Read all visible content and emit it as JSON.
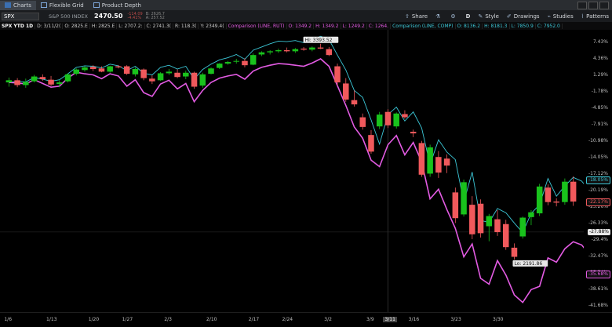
{
  "tabs": [
    {
      "label": "Charts",
      "active": true
    },
    {
      "label": "Flexible Grid",
      "active": false
    },
    {
      "label": "Product Depth",
      "active": false
    }
  ],
  "toolbar": {
    "symbol": "SPX",
    "description": "S&P 500 INDEX",
    "last_price": "2470.50",
    "change": "-114.09",
    "change_pct": "-4.41%",
    "bid": "B: 2626.7",
    "ask": "A: 257.52",
    "buttons": [
      "Share",
      "D",
      "Style",
      "Drawings",
      "Studies",
      "Patterns"
    ]
  },
  "infobar": {
    "title": "SPX YTD 1D",
    "ohlc": [
      "D: 3/11/2(",
      "O: 2825.E",
      "H: 2825.E",
      "L: 2707.2:",
      "C: 2741.3(",
      "R: 118.3(",
      "Y: 2349.4("
    ],
    "comp1": {
      "name": "Comparison (LINE, RUT)",
      "vals": [
        "O: 1349.2",
        "H: 1349.2",
        "L: 1249.2",
        "C: 1264."
      ]
    },
    "comp2": {
      "name": "Comparison (LINE, COMP)",
      "vals": [
        "O: 8136.2",
        "H: 8181.3",
        "L: 7850.9",
        "C: 7952.0"
      ]
    }
  },
  "annotations": {
    "hi": "Hi: 3393.52",
    "lo": "Lo: 2191.86"
  },
  "colors": {
    "up": "#19c21c",
    "down": "#f0595c",
    "rut": "#e35be3",
    "comp": "#3cc8d8",
    "bg": "#000000"
  },
  "chart_data": {
    "type": "candlestick",
    "y_axis_ticks": [
      "7.43%",
      "4.36%",
      "1.29%",
      "-1.78%",
      "-4.85%",
      "-7.91%",
      "-10.98%",
      "-14.05%",
      "-17.12%",
      "-20.19%",
      "-23.26%",
      "-26.33%",
      "-29.4%",
      "-32.47%",
      "-35.54%",
      "-38.61%",
      "-41.68%"
    ],
    "y_range_pct": [
      -42.8,
      9.8
    ],
    "x_axis_ticks": [
      "1/6",
      "1/13",
      "1/20",
      "1/27",
      "2/3",
      "2/10",
      "2/17",
      "2/24",
      "3/2",
      "3/9",
      "3/11",
      "3/16",
      "3/23",
      "3/30"
    ],
    "highlighted_x_tick": "3/11",
    "badges": [
      {
        "label": "-18.05%",
        "value": -18.05,
        "color": "#3cc8d8"
      },
      {
        "label": "-22.17%",
        "value": -22.17,
        "color": "#f0595c"
      },
      {
        "label": "-27.88%",
        "value": -27.88,
        "color": "#e6e6e6"
      },
      {
        "label": "-35.68%",
        "value": -35.68,
        "color": "#e35be3"
      }
    ],
    "candles": [
      {
        "o": 0.0,
        "h": 0.9,
        "l": -0.8,
        "c": 0.4
      },
      {
        "o": 0.4,
        "h": 0.8,
        "l": -0.9,
        "c": -0.5
      },
      {
        "o": -0.5,
        "h": 0.7,
        "l": -1.0,
        "c": 0.1
      },
      {
        "o": 0.2,
        "h": 1.4,
        "l": 0.0,
        "c": 1.1
      },
      {
        "o": 1.0,
        "h": 1.5,
        "l": 0.3,
        "c": 0.6
      },
      {
        "o": 0.5,
        "h": 1.2,
        "l": -0.7,
        "c": -0.4
      },
      {
        "o": -0.3,
        "h": 0.4,
        "l": -0.9,
        "c": 0.0
      },
      {
        "o": 0.2,
        "h": 1.7,
        "l": 0.0,
        "c": 1.5
      },
      {
        "o": 1.6,
        "h": 2.6,
        "l": 1.3,
        "c": 2.4
      },
      {
        "o": 2.3,
        "h": 3.0,
        "l": 2.0,
        "c": 2.8
      },
      {
        "o": 2.9,
        "h": 3.2,
        "l": 2.1,
        "c": 2.5
      },
      {
        "o": 2.6,
        "h": 3.0,
        "l": 1.9,
        "c": 2.0
      },
      {
        "o": 2.0,
        "h": 3.1,
        "l": 1.8,
        "c": 3.0
      },
      {
        "o": 3.0,
        "h": 3.2,
        "l": 2.6,
        "c": 2.8
      },
      {
        "o": 3.0,
        "h": 3.2,
        "l": 1.4,
        "c": 1.6
      },
      {
        "o": 1.5,
        "h": 2.8,
        "l": 1.1,
        "c": 2.5
      },
      {
        "o": 2.4,
        "h": 2.6,
        "l": 0.4,
        "c": 0.8
      },
      {
        "o": 0.7,
        "h": 1.3,
        "l": -0.3,
        "c": 0.2
      },
      {
        "o": 0.4,
        "h": 1.9,
        "l": 0.3,
        "c": 1.7
      },
      {
        "o": 1.7,
        "h": 2.5,
        "l": 1.4,
        "c": 2.0
      },
      {
        "o": 1.8,
        "h": 2.4,
        "l": 0.8,
        "c": 1.0
      },
      {
        "o": 1.1,
        "h": 2.2,
        "l": 0.6,
        "c": 1.8
      },
      {
        "o": 1.8,
        "h": 2.0,
        "l": -1.2,
        "c": -0.8
      },
      {
        "o": -0.6,
        "h": 1.8,
        "l": -1.0,
        "c": 1.5
      },
      {
        "o": 1.6,
        "h": 2.8,
        "l": 1.5,
        "c": 2.6
      },
      {
        "o": 2.7,
        "h": 3.6,
        "l": 2.5,
        "c": 3.5
      },
      {
        "o": 3.5,
        "h": 4.0,
        "l": 3.3,
        "c": 3.8
      },
      {
        "o": 3.9,
        "h": 4.4,
        "l": 3.5,
        "c": 4.0
      },
      {
        "o": 4.0,
        "h": 4.5,
        "l": 2.8,
        "c": 3.2
      },
      {
        "o": 3.3,
        "h": 5.4,
        "l": 3.2,
        "c": 5.1
      },
      {
        "o": 5.2,
        "h": 5.8,
        "l": 4.9,
        "c": 5.6
      },
      {
        "o": 5.6,
        "h": 6.0,
        "l": 5.2,
        "c": 5.8
      },
      {
        "o": 5.8,
        "h": 6.3,
        "l": 5.5,
        "c": 6.0
      },
      {
        "o": 6.0,
        "h": 6.5,
        "l": 5.6,
        "c": 5.8
      },
      {
        "o": 5.8,
        "h": 6.4,
        "l": 5.5,
        "c": 6.2
      },
      {
        "o": 6.3,
        "h": 6.6,
        "l": 5.9,
        "c": 6.1
      },
      {
        "o": 6.1,
        "h": 6.7,
        "l": 5.8,
        "c": 6.5
      },
      {
        "o": 6.5,
        "h": 7.2,
        "l": 6.2,
        "c": 6.3
      },
      {
        "o": 6.2,
        "h": 6.6,
        "l": 4.9,
        "c": 5.1
      },
      {
        "o": 3.0,
        "h": 3.5,
        "l": -0.6,
        "c": 0.0
      },
      {
        "o": -0.2,
        "h": 0.8,
        "l": -3.6,
        "c": -3.2
      },
      {
        "o": -3.3,
        "h": -1.5,
        "l": -4.5,
        "c": -4.1
      },
      {
        "o": -6.5,
        "h": -5.8,
        "l": -8.8,
        "c": -8.3
      },
      {
        "o": -9.8,
        "h": -8.9,
        "l": -13.3,
        "c": -12.9
      },
      {
        "o": -8.2,
        "h": -5.5,
        "l": -8.7,
        "c": -6.0
      },
      {
        "o": -5.5,
        "h": -5.0,
        "l": -8.5,
        "c": -8.0
      },
      {
        "o": -8.2,
        "h": -5.6,
        "l": -8.6,
        "c": -5.8
      },
      {
        "o": -5.9,
        "h": -5.2,
        "l": -6.8,
        "c": -6.5
      },
      {
        "o": -9.2,
        "h": -8.8,
        "l": -10.2,
        "c": -9.5
      },
      {
        "o": -11.3,
        "h": -10.9,
        "l": -17.6,
        "c": -17.2
      },
      {
        "o": -17.0,
        "h": -11.6,
        "l": -17.6,
        "c": -12.1
      },
      {
        "o": -13.9,
        "h": -12.8,
        "l": -17.8,
        "c": -16.8
      },
      {
        "o": -14.2,
        "h": -13.4,
        "l": -16.9,
        "c": -15.5
      },
      {
        "o": -20.5,
        "h": -19.6,
        "l": -26.2,
        "c": -25.3
      },
      {
        "o": -24.6,
        "h": -18.1,
        "l": -25.0,
        "c": -18.6
      },
      {
        "o": -22.8,
        "h": -21.2,
        "l": -29.2,
        "c": -28.3
      },
      {
        "o": -22.6,
        "h": -21.8,
        "l": -28.9,
        "c": -28.1
      },
      {
        "o": -26.8,
        "h": -24.5,
        "l": -29.6,
        "c": -24.9
      },
      {
        "o": -25.5,
        "h": -23.8,
        "l": -28.6,
        "c": -27.9
      },
      {
        "o": -26.4,
        "h": -25.6,
        "l": -31.2,
        "c": -30.7
      },
      {
        "o": -30.8,
        "h": -30.0,
        "l": -33.0,
        "c": -32.5
      },
      {
        "o": -28.7,
        "h": -25.0,
        "l": -29.1,
        "c": -25.2
      },
      {
        "o": -25.1,
        "h": -23.8,
        "l": -26.6,
        "c": -24.2
      },
      {
        "o": -24.4,
        "h": -18.9,
        "l": -24.9,
        "c": -19.4
      },
      {
        "o": -19.6,
        "h": -19.0,
        "l": -22.9,
        "c": -22.3
      },
      {
        "o": -22.2,
        "h": -21.6,
        "l": -23.1,
        "c": -22.4
      },
      {
        "o": -22.3,
        "h": -17.9,
        "l": -22.8,
        "c": -18.5
      },
      {
        "o": -18.5,
        "h": -17.5,
        "l": -23.0,
        "c": -22.2
      }
    ],
    "x_day_index_for_ticks": [
      0,
      5,
      10,
      14,
      19,
      24,
      29,
      33,
      38,
      43,
      45,
      48,
      53,
      58
    ],
    "series": [
      {
        "name": "Comparison (LINE, COMP)",
        "color": "#3cc8d8",
        "values": [
          0,
          0.2,
          0.1,
          0.9,
          0.6,
          0.2,
          0.5,
          1.6,
          2.8,
          3.1,
          3.0,
          2.7,
          3.4,
          3.1,
          2.2,
          3.0,
          1.7,
          1.4,
          2.8,
          3.2,
          2.5,
          3.0,
          0.6,
          2.4,
          3.4,
          4.2,
          4.6,
          5.2,
          4.3,
          6.0,
          6.6,
          7.2,
          7.7,
          7.6,
          7.8,
          7.4,
          7.9,
          8.6,
          8.0,
          5.1,
          2.3,
          -1.5,
          -2.8,
          -7.0,
          -11.5,
          -6.0,
          -4.6,
          -7.2,
          -5.5,
          -8.5,
          -15.3,
          -10.7,
          -13.0,
          -14.4,
          -22.3,
          -16.7,
          -25.7,
          -26.1,
          -23.5,
          -24.3,
          -26.2,
          -28.0,
          -24.4,
          -22.8,
          -17.9,
          -21.2,
          -19.3,
          -17.7,
          -18.4,
          -20.3,
          -18.1
        ]
      },
      {
        "name": "Comparison (LINE, RUT)",
        "color": "#e35be3",
        "values": [
          0,
          -0.1,
          -0.3,
          0.5,
          -0.2,
          -0.9,
          -0.7,
          0.8,
          1.9,
          1.6,
          1.4,
          0.7,
          1.6,
          1.2,
          -0.7,
          0.5,
          -1.9,
          -2.6,
          -0.3,
          0.4,
          -1.2,
          -0.2,
          -3.6,
          -1.5,
          0.0,
          0.8,
          1.2,
          1.5,
          0.6,
          2.1,
          2.8,
          3.2,
          3.5,
          3.4,
          3.2,
          3.0,
          3.6,
          4.4,
          3.0,
          -0.6,
          -4.3,
          -8.3,
          -10.4,
          -14.5,
          -15.7,
          -11.6,
          -9.9,
          -13.5,
          -11.2,
          -14.8,
          -21.7,
          -19.9,
          -23.7,
          -27.2,
          -32.5,
          -30.1,
          -36.5,
          -37.6,
          -33.2,
          -35.9,
          -39.6,
          -41.0,
          -38.6,
          -38.0,
          -32.7,
          -33.5,
          -31.0,
          -29.7,
          -30.3,
          -32.2,
          -35.7
        ]
      }
    ]
  }
}
